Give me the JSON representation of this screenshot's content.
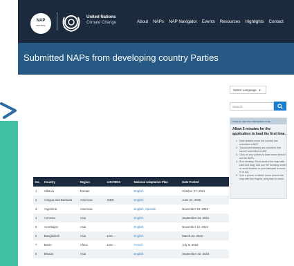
{
  "header": {
    "nap_logo": {
      "text": "NAP",
      "subtext": "CENTRAL"
    },
    "org_name": "United Nations",
    "org_sub": "Climate Change",
    "nav": [
      "About",
      "NAPs",
      "NAP Navigator",
      "Events",
      "Resources",
      "Highlights",
      "Contact"
    ]
  },
  "banner": {
    "title": "Submitted NAPs from developing country Parties"
  },
  "sidebar": {
    "language_select": "Select Language",
    "search_placeholder": "Search",
    "help_header": "How to use the interactive map",
    "help_bold": "Allow 5 minutes for the application to load the first time.",
    "help_items": [
      "Dark shades mean the country has submitted a NAP.",
      "Translucent shades are countries that haven't submitted a NAP.",
      "Click on any country to learn more about it and its NAPs.",
      "If on desktop: Move around the map with click and drag, and use the scrolling wheel or scroll function in your trackpad to zoom in or out.",
      "If on a phone or tablet: move around the map with two fingers, and pinch to zoom."
    ]
  },
  "table": {
    "headers": [
      "No.",
      "Country",
      "Region",
      "LDC/SIDS",
      "National Adaptation Plan",
      "Date Posted"
    ],
    "rows": [
      [
        "1",
        "Albania",
        "Europe",
        "",
        "English",
        "October 27, 2021"
      ],
      [
        "2",
        "Antigua and Barbuda",
        "Americas",
        "SIDS",
        "English",
        "June 24, 2025"
      ],
      [
        "3",
        "Argentina",
        "Americas",
        "",
        "English, Spanish",
        "November 23, 2023"
      ],
      [
        "4",
        "Armenia",
        "Asia",
        "",
        "English",
        "September 24, 2021"
      ],
      [
        "5",
        "Azerbaijan",
        "Asia",
        "",
        "English",
        "November 12, 2024"
      ],
      [
        "6",
        "Bangladesh",
        "Asia",
        "LDC",
        "English",
        "March 22, 2022"
      ],
      [
        "7",
        "Benin",
        "Africa",
        "LDC",
        "French",
        "July 9, 2022"
      ],
      [
        "8",
        "Bhutan",
        "Asia",
        "",
        "English",
        "September 22, 2023"
      ]
    ]
  },
  "colors": {
    "header_bg": "#1b2a3c",
    "banner_bg": "#265a84",
    "link": "#3a84c8",
    "accent_teal": "#3fc0a4",
    "search_button": "#1a7fd0"
  }
}
